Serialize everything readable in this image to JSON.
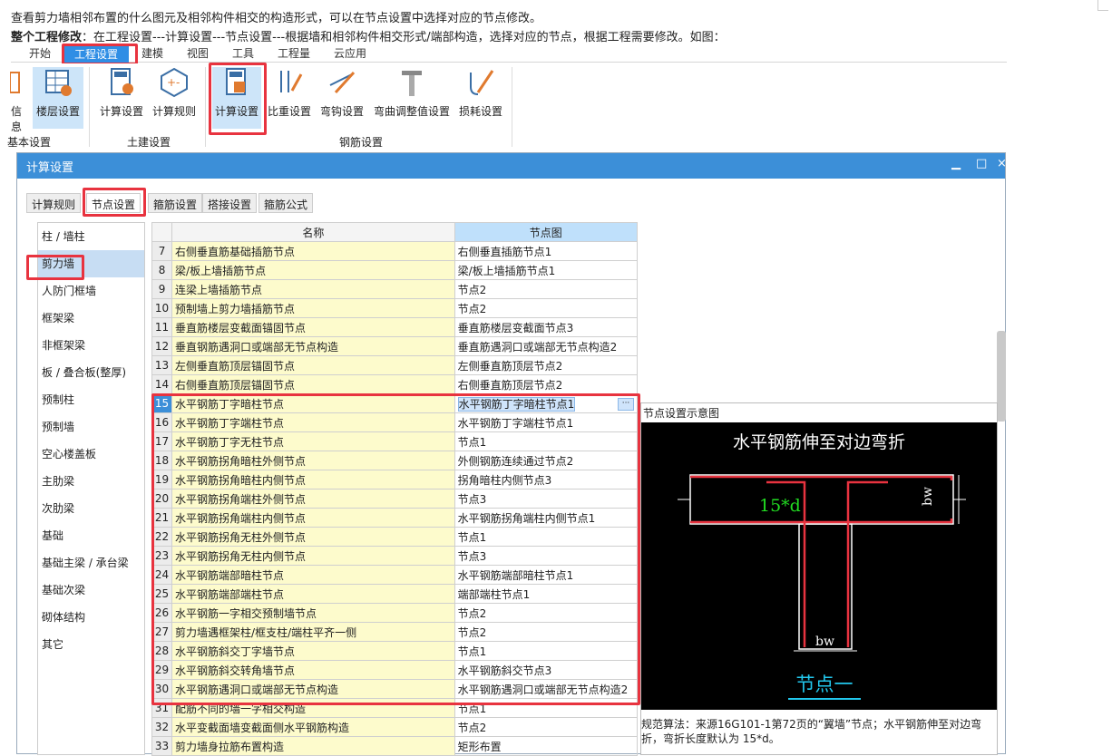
{
  "intro": {
    "line1": "查看剪力墙相邻布置的什么图元及相邻构件相交的构造形式，可以在节点设置中选择对应的节点修改。",
    "line2_bold": "整个工程修改",
    "line2_rest": "：在工程设置---计算设置---节点设置---根据墙和相邻构件相交形式/端部构造，选择对应的节点，根据工程需要修改。如图："
  },
  "ribbon": {
    "tabs": [
      "开始",
      "工程设置",
      "建模",
      "视图",
      "工具",
      "工程量",
      "云应用"
    ],
    "active_tab": "工程设置",
    "buttons": [
      "信息",
      "楼层设置",
      "计算设置",
      "计算规则",
      "计算设置",
      "比重设置",
      "弯钩设置",
      "弯曲调整值设置",
      "损耗设置"
    ],
    "groups": [
      "基本设置",
      "土建设置",
      "钢筋设置"
    ],
    "colors": {
      "accent": "#2f8ee5",
      "highlight": "#e8333f"
    }
  },
  "dialog": {
    "title": "计算设置",
    "controls": [
      "▁",
      "□",
      "×"
    ],
    "tabs": [
      "计算规则",
      "节点设置",
      "箍筋设置",
      "搭接设置",
      "箍筋公式"
    ],
    "active_tab": "节点设置",
    "categories": [
      "柱 / 墙柱",
      "剪力墙",
      "人防门框墙",
      "框架梁",
      "非框架梁",
      "板 / 叠合板(整厚)",
      "预制柱",
      "预制墙",
      "空心楼盖板",
      "主肋梁",
      "次肋梁",
      "基础",
      "基础主梁 / 承台梁",
      "基础次梁",
      "砌体结构",
      "其它"
    ],
    "selected_category": "剪力墙",
    "table": {
      "headers": [
        "名称",
        "节点图"
      ],
      "rows": [
        {
          "n": "7",
          "name": "右侧垂直筋基础插筋节点",
          "node": "右侧垂直插筋节点1"
        },
        {
          "n": "8",
          "name": "梁/板上墙插筋节点",
          "node": "梁/板上墙插筋节点1"
        },
        {
          "n": "9",
          "name": "连梁上墙插筋节点",
          "node": "节点2"
        },
        {
          "n": "10",
          "name": "预制墙上剪力墙插筋节点",
          "node": "节点2"
        },
        {
          "n": "11",
          "name": "垂直筋楼层变截面锚固节点",
          "node": "垂直筋楼层变截面节点3"
        },
        {
          "n": "12",
          "name": "垂直钢筋遇洞口或端部无节点构造",
          "node": "垂直筋遇洞口或端部无节点构造2"
        },
        {
          "n": "13",
          "name": "左侧垂直筋顶层锚固节点",
          "node": "左侧垂直筋顶层节点2"
        },
        {
          "n": "14",
          "name": "右侧垂直筋顶层锚固节点",
          "node": "右侧垂直筋顶层节点2"
        },
        {
          "n": "15",
          "name": "水平钢筋丁字暗柱节点",
          "node": "水平钢筋丁字暗柱节点1"
        },
        {
          "n": "16",
          "name": "水平钢筋丁字端柱节点",
          "node": "水平钢筋丁字端柱节点1"
        },
        {
          "n": "17",
          "name": "水平钢筋丁字无柱节点",
          "node": "节点1"
        },
        {
          "n": "18",
          "name": "水平钢筋拐角暗柱外侧节点",
          "node": "外侧钢筋连续通过节点2"
        },
        {
          "n": "19",
          "name": "水平钢筋拐角暗柱内侧节点",
          "node": "拐角暗柱内侧节点3"
        },
        {
          "n": "20",
          "name": "水平钢筋拐角端柱外侧节点",
          "node": "节点3"
        },
        {
          "n": "21",
          "name": "水平钢筋拐角端柱内侧节点",
          "node": "水平钢筋拐角端柱内侧节点1"
        },
        {
          "n": "22",
          "name": "水平钢筋拐角无柱外侧节点",
          "node": "节点1"
        },
        {
          "n": "23",
          "name": "水平钢筋拐角无柱内侧节点",
          "node": "节点3"
        },
        {
          "n": "24",
          "name": "水平钢筋端部暗柱节点",
          "node": "水平钢筋端部暗柱节点1"
        },
        {
          "n": "25",
          "name": "水平钢筋端部端柱节点",
          "node": "端部端柱节点1"
        },
        {
          "n": "26",
          "name": "水平钢筋一字相交预制墙节点",
          "node": "节点2"
        },
        {
          "n": "27",
          "name": "剪力墙遇框架柱/框支柱/端柱平齐一侧",
          "node": "节点2"
        },
        {
          "n": "28",
          "name": "水平钢筋斜交丁字墙节点",
          "node": "节点1"
        },
        {
          "n": "29",
          "name": "水平钢筋斜交转角墙节点",
          "node": "水平钢筋斜交节点3"
        },
        {
          "n": "30",
          "name": "水平钢筋遇洞口或端部无节点构造",
          "node": "水平钢筋遇洞口或端部无节点构造2"
        },
        {
          "n": "31",
          "name": "配筋不同的墙一字相交构造",
          "node": "节点1"
        },
        {
          "n": "32",
          "name": "水平变截面墙变截面侧水平钢筋构造",
          "node": "节点2"
        },
        {
          "n": "33",
          "name": "剪力墙身拉筋布置构造",
          "node": "矩形布置"
        }
      ],
      "selected_row": "15"
    },
    "preview": {
      "title": "节点设置示意图",
      "heading": "水平钢筋伸至对边弯折",
      "dim1": "15*d",
      "dim2": "bw",
      "dim3": "bw",
      "caption": "节点一",
      "description": "规范算法：来源16G101-1第72页的“翼墙”节点；水平钢筋伸至对边弯折，弯折长度默认为 15*d。"
    }
  }
}
